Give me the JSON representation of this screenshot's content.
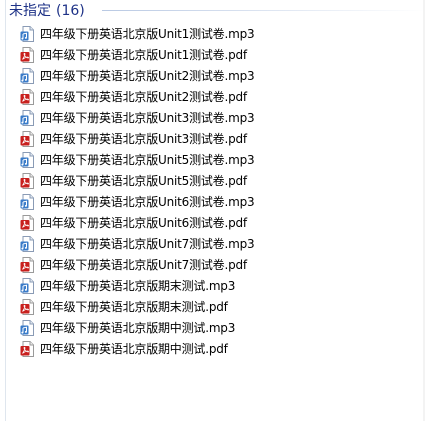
{
  "group": {
    "title": "未指定",
    "count": "(16)"
  },
  "colors": {
    "header_text": "#1e3287",
    "pdf_icon": "#c8201e",
    "mp3_icon": "#3a7bc8"
  },
  "files": [
    {
      "name": "四年级下册英语北京版Unit1测试卷.mp3",
      "type": "mp3"
    },
    {
      "name": "四年级下册英语北京版Unit1测试卷.pdf",
      "type": "pdf"
    },
    {
      "name": "四年级下册英语北京版Unit2测试卷.mp3",
      "type": "mp3"
    },
    {
      "name": "四年级下册英语北京版Unit2测试卷.pdf",
      "type": "pdf"
    },
    {
      "name": "四年级下册英语北京版Unit3测试卷.mp3",
      "type": "mp3"
    },
    {
      "name": "四年级下册英语北京版Unit3测试卷.pdf",
      "type": "pdf"
    },
    {
      "name": "四年级下册英语北京版Unit5测试卷.mp3",
      "type": "mp3"
    },
    {
      "name": "四年级下册英语北京版Unit5测试卷.pdf",
      "type": "pdf"
    },
    {
      "name": "四年级下册英语北京版Unit6测试卷.mp3",
      "type": "mp3"
    },
    {
      "name": "四年级下册英语北京版Unit6测试卷.pdf",
      "type": "pdf"
    },
    {
      "name": "四年级下册英语北京版Unit7测试卷.mp3",
      "type": "mp3"
    },
    {
      "name": "四年级下册英语北京版Unit7测试卷.pdf",
      "type": "pdf"
    },
    {
      "name": "四年级下册英语北京版期末测试.mp3",
      "type": "mp3"
    },
    {
      "name": "四年级下册英语北京版期末测试.pdf",
      "type": "pdf"
    },
    {
      "name": "四年级下册英语北京版期中测试.mp3",
      "type": "mp3"
    },
    {
      "name": "四年级下册英语北京版期中测试.pdf",
      "type": "pdf"
    }
  ]
}
